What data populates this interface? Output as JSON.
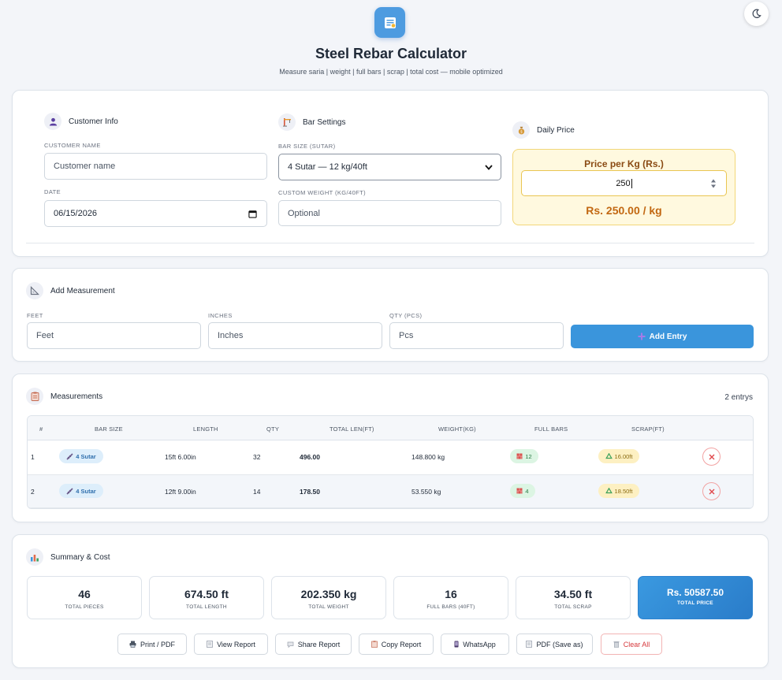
{
  "app": {
    "title": "Steel Rebar Calculator",
    "subtitle": "Measure saria | weight | full bars | scrap | total cost — mobile optimized",
    "logo_icon": "calculator-note-icon",
    "theme_icon": "moon-icon"
  },
  "customer": {
    "heading": "Customer Info",
    "name_label": "CUSTOMER NAME",
    "name_placeholder": "Customer name",
    "date_label": "DATE",
    "date_value": "06/15/2026"
  },
  "bar_settings": {
    "heading": "Bar Settings",
    "size_label": "BAR SIZE (SUTAR)",
    "size_selected": "4 Sutar — 12 kg/40ft",
    "custom_label": "CUSTOM WEIGHT (KG/40FT)",
    "custom_placeholder": "Optional"
  },
  "daily_price": {
    "heading": "Daily Price",
    "price_label": "Price per Kg (Rs.)",
    "price_value": "250",
    "price_display": "Rs. 250.00 / kg"
  },
  "add_measurement": {
    "heading": "Add Measurement",
    "feet_label": "FEET",
    "feet_placeholder": "Feet",
    "inches_label": "INCHES",
    "inches_placeholder": "Inches",
    "qty_label": "QTY (PCS)",
    "qty_placeholder": "Pcs",
    "button_label": "Add Entry"
  },
  "measurements": {
    "heading": "Measurements",
    "count_text": "2 entrys",
    "columns": [
      "#",
      "BAR SIZE",
      "LENGTH",
      "QTY",
      "TOTAL LEN(FT)",
      "WEIGHT(KG)",
      "FULL BARS",
      "SCRAP(FT)"
    ],
    "rows": [
      {
        "num": "1",
        "bar_size": "4 Sutar",
        "length": "15ft 6.00in",
        "qty": "32",
        "total_len": "496.00",
        "weight": "148.800 kg",
        "full_bars": "12",
        "scrap": "16.00ft"
      },
      {
        "num": "2",
        "bar_size": "4 Sutar",
        "length": "12ft 9.00in",
        "qty": "14",
        "total_len": "178.50",
        "weight": "53.550 kg",
        "full_bars": "4",
        "scrap": "18.50ft"
      }
    ]
  },
  "summary": {
    "heading": "Summary & Cost",
    "stats": [
      {
        "value": "46",
        "label": "TOTAL PIECES"
      },
      {
        "value": "674.50 ft",
        "label": "TOTAL LENGTH"
      },
      {
        "value": "202.350 kg",
        "label": "TOTAL WEIGHT"
      },
      {
        "value": "16",
        "label": "FULL BARS (40FT)"
      },
      {
        "value": "34.50 ft",
        "label": "TOTAL SCRAP"
      },
      {
        "value": "Rs. 50587.50",
        "label": "TOTAL PRICE"
      }
    ]
  },
  "actions": {
    "print": "Print / PDF",
    "view": "View Report",
    "share": "Share Report",
    "copy": "Copy Report",
    "whatsapp": "WhatsApp",
    "pdf_save": "PDF (Save as)",
    "clear": "Clear All"
  },
  "colors": {
    "accent": "#3a95dc",
    "price_text": "#c26812",
    "danger": "#d6383c"
  }
}
